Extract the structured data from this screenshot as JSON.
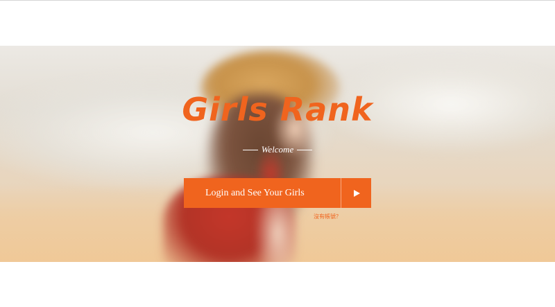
{
  "brand": {
    "title": "Girls Rank",
    "welcome": "Welcome"
  },
  "login": {
    "button_label": "Login and See Your Girls",
    "icon": "play-arrow-icon"
  },
  "signup": {
    "link_text": "沒有帳號？"
  },
  "colors": {
    "accent": "#f0641e",
    "white": "#ffffff"
  }
}
